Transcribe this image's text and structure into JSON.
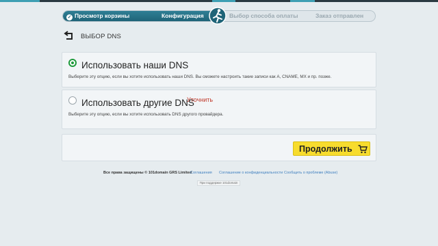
{
  "steps": {
    "cart_review": "Просмотр корзины",
    "configuration": "Конфигурация",
    "payment_method": "Выбор способа оплаты",
    "order_sent": "Заказ отправлен"
  },
  "page": {
    "title": "ВЫБОР DNS"
  },
  "options": [
    {
      "title": "Использовать наши DNS",
      "description": "Выберите эту опцию, если вы хотите использовать наши DNS. Вы сможете настроить такие записи как A, CNAME, MX и пр. позже.",
      "selected": true
    },
    {
      "title": "Использовать другие DNS",
      "clarify_link": "Уточнить",
      "description": "Выберите эту опцию, если вы хотите использовать DNS другого провайдера.",
      "selected": false
    }
  ],
  "actions": {
    "continue_label": "Продолжить"
  },
  "footer": {
    "copyright": "Все права защищены © 101domain GRS Limited",
    "links": [
      "Соглашения",
      "Соглашение о конфиденциальности",
      "Сообщить о проблеме (Abuse)"
    ],
    "support_button": "При поддержке 101domain"
  },
  "colors": {
    "accent": "#1f6478",
    "button": "#f7dc2e",
    "selected_radio": "#1f9a3c",
    "link": "#3f7fbf",
    "warning_link": "#c0392b"
  }
}
